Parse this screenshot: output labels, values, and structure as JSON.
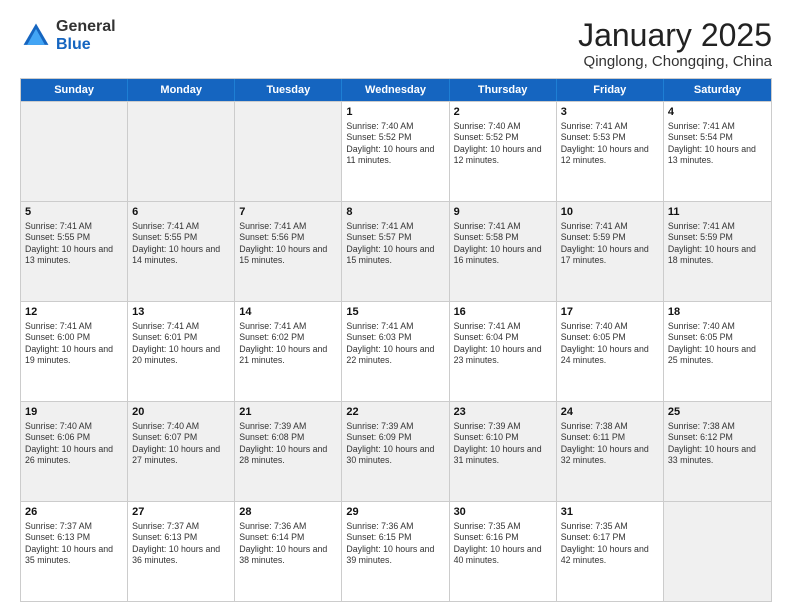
{
  "header": {
    "logo_general": "General",
    "logo_blue": "Blue",
    "month_title": "January 2025",
    "subtitle": "Qinglong, Chongqing, China"
  },
  "weekdays": [
    "Sunday",
    "Monday",
    "Tuesday",
    "Wednesday",
    "Thursday",
    "Friday",
    "Saturday"
  ],
  "weeks": [
    [
      {
        "day": "",
        "info": "",
        "empty": true
      },
      {
        "day": "",
        "info": "",
        "empty": true
      },
      {
        "day": "",
        "info": "",
        "empty": true
      },
      {
        "day": "1",
        "info": "Sunrise: 7:40 AM\nSunset: 5:52 PM\nDaylight: 10 hours\nand 11 minutes.",
        "empty": false
      },
      {
        "day": "2",
        "info": "Sunrise: 7:40 AM\nSunset: 5:52 PM\nDaylight: 10 hours\nand 12 minutes.",
        "empty": false
      },
      {
        "day": "3",
        "info": "Sunrise: 7:41 AM\nSunset: 5:53 PM\nDaylight: 10 hours\nand 12 minutes.",
        "empty": false
      },
      {
        "day": "4",
        "info": "Sunrise: 7:41 AM\nSunset: 5:54 PM\nDaylight: 10 hours\nand 13 minutes.",
        "empty": false
      }
    ],
    [
      {
        "day": "5",
        "info": "Sunrise: 7:41 AM\nSunset: 5:55 PM\nDaylight: 10 hours\nand 13 minutes.",
        "empty": false
      },
      {
        "day": "6",
        "info": "Sunrise: 7:41 AM\nSunset: 5:55 PM\nDaylight: 10 hours\nand 14 minutes.",
        "empty": false
      },
      {
        "day": "7",
        "info": "Sunrise: 7:41 AM\nSunset: 5:56 PM\nDaylight: 10 hours\nand 15 minutes.",
        "empty": false
      },
      {
        "day": "8",
        "info": "Sunrise: 7:41 AM\nSunset: 5:57 PM\nDaylight: 10 hours\nand 15 minutes.",
        "empty": false
      },
      {
        "day": "9",
        "info": "Sunrise: 7:41 AM\nSunset: 5:58 PM\nDaylight: 10 hours\nand 16 minutes.",
        "empty": false
      },
      {
        "day": "10",
        "info": "Sunrise: 7:41 AM\nSunset: 5:59 PM\nDaylight: 10 hours\nand 17 minutes.",
        "empty": false
      },
      {
        "day": "11",
        "info": "Sunrise: 7:41 AM\nSunset: 5:59 PM\nDaylight: 10 hours\nand 18 minutes.",
        "empty": false
      }
    ],
    [
      {
        "day": "12",
        "info": "Sunrise: 7:41 AM\nSunset: 6:00 PM\nDaylight: 10 hours\nand 19 minutes.",
        "empty": false
      },
      {
        "day": "13",
        "info": "Sunrise: 7:41 AM\nSunset: 6:01 PM\nDaylight: 10 hours\nand 20 minutes.",
        "empty": false
      },
      {
        "day": "14",
        "info": "Sunrise: 7:41 AM\nSunset: 6:02 PM\nDaylight: 10 hours\nand 21 minutes.",
        "empty": false
      },
      {
        "day": "15",
        "info": "Sunrise: 7:41 AM\nSunset: 6:03 PM\nDaylight: 10 hours\nand 22 minutes.",
        "empty": false
      },
      {
        "day": "16",
        "info": "Sunrise: 7:41 AM\nSunset: 6:04 PM\nDaylight: 10 hours\nand 23 minutes.",
        "empty": false
      },
      {
        "day": "17",
        "info": "Sunrise: 7:40 AM\nSunset: 6:05 PM\nDaylight: 10 hours\nand 24 minutes.",
        "empty": false
      },
      {
        "day": "18",
        "info": "Sunrise: 7:40 AM\nSunset: 6:05 PM\nDaylight: 10 hours\nand 25 minutes.",
        "empty": false
      }
    ],
    [
      {
        "day": "19",
        "info": "Sunrise: 7:40 AM\nSunset: 6:06 PM\nDaylight: 10 hours\nand 26 minutes.",
        "empty": false
      },
      {
        "day": "20",
        "info": "Sunrise: 7:40 AM\nSunset: 6:07 PM\nDaylight: 10 hours\nand 27 minutes.",
        "empty": false
      },
      {
        "day": "21",
        "info": "Sunrise: 7:39 AM\nSunset: 6:08 PM\nDaylight: 10 hours\nand 28 minutes.",
        "empty": false
      },
      {
        "day": "22",
        "info": "Sunrise: 7:39 AM\nSunset: 6:09 PM\nDaylight: 10 hours\nand 30 minutes.",
        "empty": false
      },
      {
        "day": "23",
        "info": "Sunrise: 7:39 AM\nSunset: 6:10 PM\nDaylight: 10 hours\nand 31 minutes.",
        "empty": false
      },
      {
        "day": "24",
        "info": "Sunrise: 7:38 AM\nSunset: 6:11 PM\nDaylight: 10 hours\nand 32 minutes.",
        "empty": false
      },
      {
        "day": "25",
        "info": "Sunrise: 7:38 AM\nSunset: 6:12 PM\nDaylight: 10 hours\nand 33 minutes.",
        "empty": false
      }
    ],
    [
      {
        "day": "26",
        "info": "Sunrise: 7:37 AM\nSunset: 6:13 PM\nDaylight: 10 hours\nand 35 minutes.",
        "empty": false
      },
      {
        "day": "27",
        "info": "Sunrise: 7:37 AM\nSunset: 6:13 PM\nDaylight: 10 hours\nand 36 minutes.",
        "empty": false
      },
      {
        "day": "28",
        "info": "Sunrise: 7:36 AM\nSunset: 6:14 PM\nDaylight: 10 hours\nand 38 minutes.",
        "empty": false
      },
      {
        "day": "29",
        "info": "Sunrise: 7:36 AM\nSunset: 6:15 PM\nDaylight: 10 hours\nand 39 minutes.",
        "empty": false
      },
      {
        "day": "30",
        "info": "Sunrise: 7:35 AM\nSunset: 6:16 PM\nDaylight: 10 hours\nand 40 minutes.",
        "empty": false
      },
      {
        "day": "31",
        "info": "Sunrise: 7:35 AM\nSunset: 6:17 PM\nDaylight: 10 hours\nand 42 minutes.",
        "empty": false
      },
      {
        "day": "",
        "info": "",
        "empty": true
      }
    ]
  ]
}
